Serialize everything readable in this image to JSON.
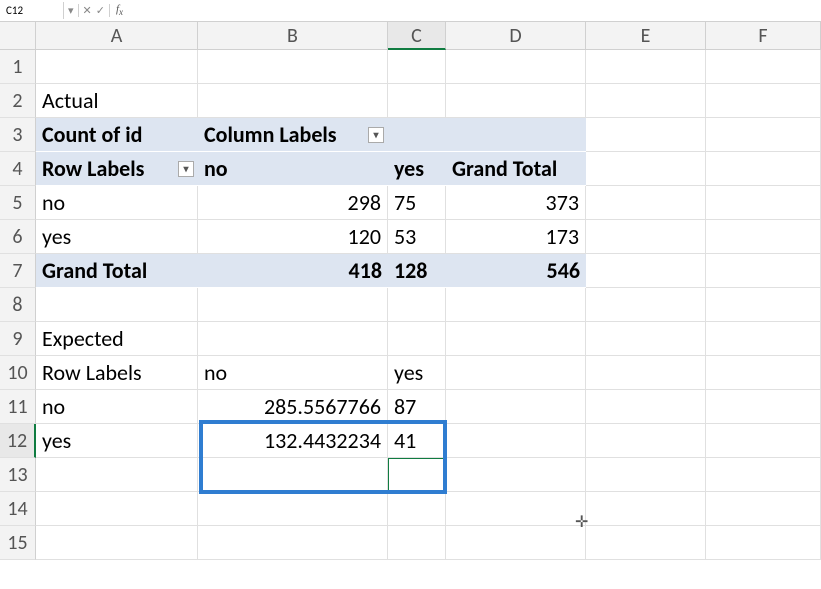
{
  "namebox": "C12",
  "formula": "",
  "columns": [
    "A",
    "B",
    "C",
    "D",
    "E",
    "F"
  ],
  "rows": [
    "1",
    "2",
    "3",
    "4",
    "5",
    "6",
    "7",
    "8",
    "9",
    "10",
    "11",
    "12",
    "13",
    "14",
    "15"
  ],
  "cells": {
    "A2": "Actual",
    "A3": "Count of id",
    "B3": "Column Labels",
    "A4": "Row Labels",
    "B4": "no",
    "C4": "yes",
    "D4": "Grand Total",
    "A5": "no",
    "B5": "298",
    "C5": "75",
    "D5": "373",
    "A6": "yes",
    "B6": "120",
    "C6": "53",
    "D6": "173",
    "A7": "Grand Total",
    "B7": "418",
    "C7": "128",
    "D7": "546",
    "A9": "Expected",
    "A10": "Row Labels",
    "B10": "no",
    "C10": "yes",
    "A11": "no",
    "B11": "285.5567766",
    "C11": "87",
    "A12": "yes",
    "B12": "132.4432234",
    "C12": "41"
  }
}
